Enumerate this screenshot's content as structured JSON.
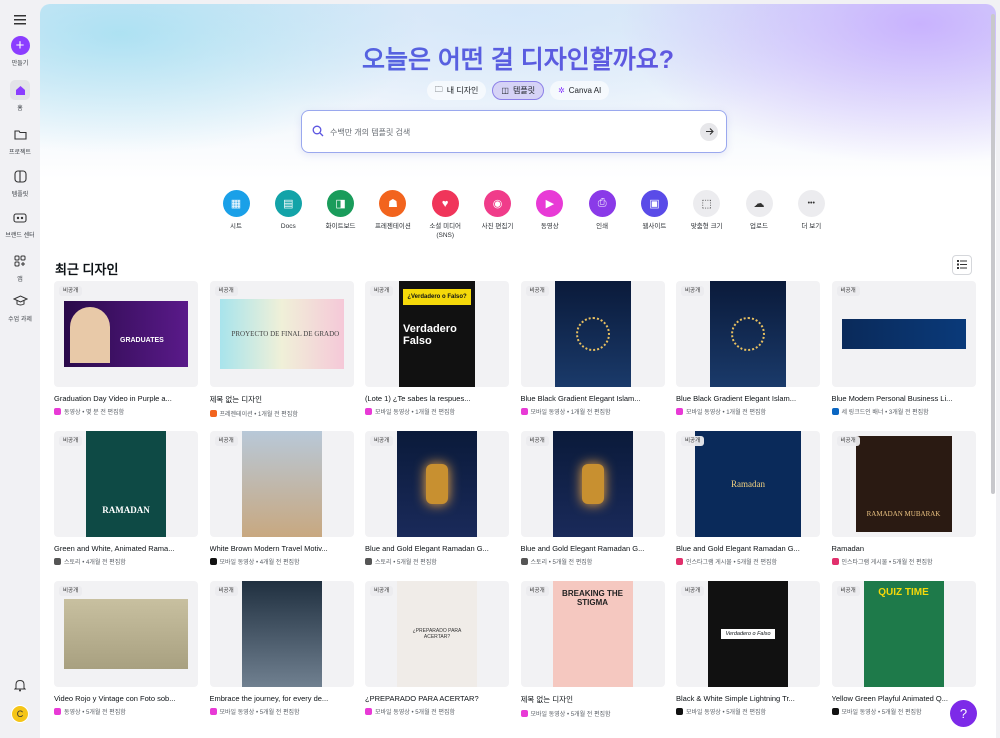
{
  "sidebar": {
    "create_label": "만들기",
    "items": [
      {
        "label": "홈",
        "icon": "home-icon"
      },
      {
        "label": "프로젝트",
        "icon": "folder-icon"
      },
      {
        "label": "템플릿",
        "icon": "template-icon"
      },
      {
        "label": "브랜드 센터",
        "icon": "brand-icon"
      },
      {
        "label": "앱",
        "icon": "apps-icon"
      },
      {
        "label": "수업 과제",
        "icon": "graduation-cap-icon"
      }
    ],
    "avatar_initial": "C"
  },
  "hero": {
    "title": "오늘은 어떤 걸 디자인할까요?",
    "modes": [
      "내 디자인",
      "템플릿",
      "Canva AI"
    ],
    "search_placeholder": "수백만 개의 템플릿 검색"
  },
  "categories": [
    {
      "label": "시트",
      "color": "#1aa0e8"
    },
    {
      "label": "Docs",
      "color": "#13a3a8"
    },
    {
      "label": "화이트보드",
      "color": "#1a9c5b"
    },
    {
      "label": "프레젠테이션",
      "color": "#f2641e"
    },
    {
      "label": "소셜 미디어\n(SNS)",
      "color": "#f0355a"
    },
    {
      "label": "사진 편집기",
      "color": "#f03c8a"
    },
    {
      "label": "동영상",
      "color": "#e83ad6"
    },
    {
      "label": "인쇄",
      "color": "#8a3ae8"
    },
    {
      "label": "웹사이트",
      "color": "#5a4be8"
    },
    {
      "label": "맞춤형 크기",
      "color": "#ececef"
    },
    {
      "label": "업로드",
      "color": "#ececef"
    },
    {
      "label": "더 보기",
      "color": "#ececef"
    }
  ],
  "recent": {
    "title": "최근 디자인",
    "badge": "비공개",
    "cards": [
      {
        "title": "Graduation Day  Video in Purple a...",
        "meta": "동영상 • 몇 분 전 편집함",
        "meta_color": "#e83ad6",
        "thumb": "graduation",
        "thumb_text": "GRADUATES"
      },
      {
        "title": "제목 없는 디자인",
        "meta": "프레젠테이션 • 1개월 전 편집함",
        "meta_color": "#f2641e",
        "thumb": "proyecto",
        "thumb_text": "PROYECTO DE FINAL DE GRADO"
      },
      {
        "title": "(Lote 1) ¿Te sabes la respues...",
        "meta": "모바일 동영상 • 1개월 전 편집함",
        "meta_color": "#e83ad6",
        "thumb": "verdadero",
        "thumb_text": "¿Verdadero o Falso?"
      },
      {
        "title": "Blue Black Gradient Elegant Islam...",
        "meta": "모바일 동영상 • 1개월 전 편집함",
        "meta_color": "#e83ad6",
        "thumb": "islamic",
        "thumb_text": ""
      },
      {
        "title": "Blue Black Gradient Elegant Islam...",
        "meta": "모바일 동영상 • 1개월 전 편집함",
        "meta_color": "#e83ad6",
        "thumb": "islamic",
        "thumb_text": ""
      },
      {
        "title": "Blue Modern Personal Business Li...",
        "meta": "세 링크드인 배너 • 3개월 전 편집함",
        "meta_color": "#0a66c2",
        "thumb": "linkedin",
        "thumb_text": ""
      },
      {
        "title": "Green and White, Animated Rama...",
        "meta": "스토리 • 4개월 전 편집함",
        "meta_color": "#555555",
        "thumb": "ramadan-green",
        "thumb_text": "RAMADAN"
      },
      {
        "title": "White Brown Modern Travel Motiv...",
        "meta": "모바일 동영상 • 4개월 전 편집함",
        "meta_color": "#111111",
        "thumb": "plane",
        "thumb_text": ""
      },
      {
        "title": "Blue and Gold Elegant Ramadan G...",
        "meta": "스토리 • 5개월 전 편집함",
        "meta_color": "#555555",
        "thumb": "lantern",
        "thumb_text": ""
      },
      {
        "title": "Blue and Gold Elegant Ramadan G...",
        "meta": "스토리 • 5개월 전 편집함",
        "meta_color": "#555555",
        "thumb": "lantern",
        "thumb_text": ""
      },
      {
        "title": "Blue and Gold Elegant Ramadan G...",
        "meta": "인스타그램 게시물 • 5개월 전 편집함",
        "meta_color": "#e1306c",
        "thumb": "moon",
        "thumb_text": "Ramadan"
      },
      {
        "title": "Ramadan",
        "meta": "인스타그램 게시물 • 5개월 전 편집함",
        "meta_color": "#e1306c",
        "thumb": "mubarak",
        "thumb_text": "RAMADAN MUBARAK"
      },
      {
        "title": "Video Rojo y Vintage con Foto sob...",
        "meta": "동영상 • 5개월 전 편집함",
        "meta_color": "#e83ad6",
        "thumb": "city",
        "thumb_text": ""
      },
      {
        "title": "Embrace the journey, for every de...",
        "meta": "모바일 동영상 • 5개월 전 편집함",
        "meta_color": "#e83ad6",
        "thumb": "wing",
        "thumb_text": ""
      },
      {
        "title": "¿PREPARADO PARA ACERTAR?",
        "meta": "모바일 동영상 • 5개월 전 편집함",
        "meta_color": "#e83ad6",
        "thumb": "preparado",
        "thumb_text": "¿PREPARADO PARA ACERTAR?"
      },
      {
        "title": "제목 없는 디자인",
        "meta": "모바일 동영상 • 5개월 전 편집함",
        "meta_color": "#e83ad6",
        "thumb": "stigma",
        "thumb_text": "BREAKING THE STIGMA"
      },
      {
        "title": "Black & White Simple Lightning Tr...",
        "meta": "모바일 동영상 • 5개월 전 편집함",
        "meta_color": "#111111",
        "thumb": "lightning",
        "thumb_text": "Verdadero o Falso"
      },
      {
        "title": "Yellow Green Playful Animated Q...",
        "meta": "모바일 동영상 • 5개월 전 편집함",
        "meta_color": "#111111",
        "thumb": "quiz",
        "thumb_text": "QUIZ TIME"
      }
    ]
  },
  "help_label": "?"
}
